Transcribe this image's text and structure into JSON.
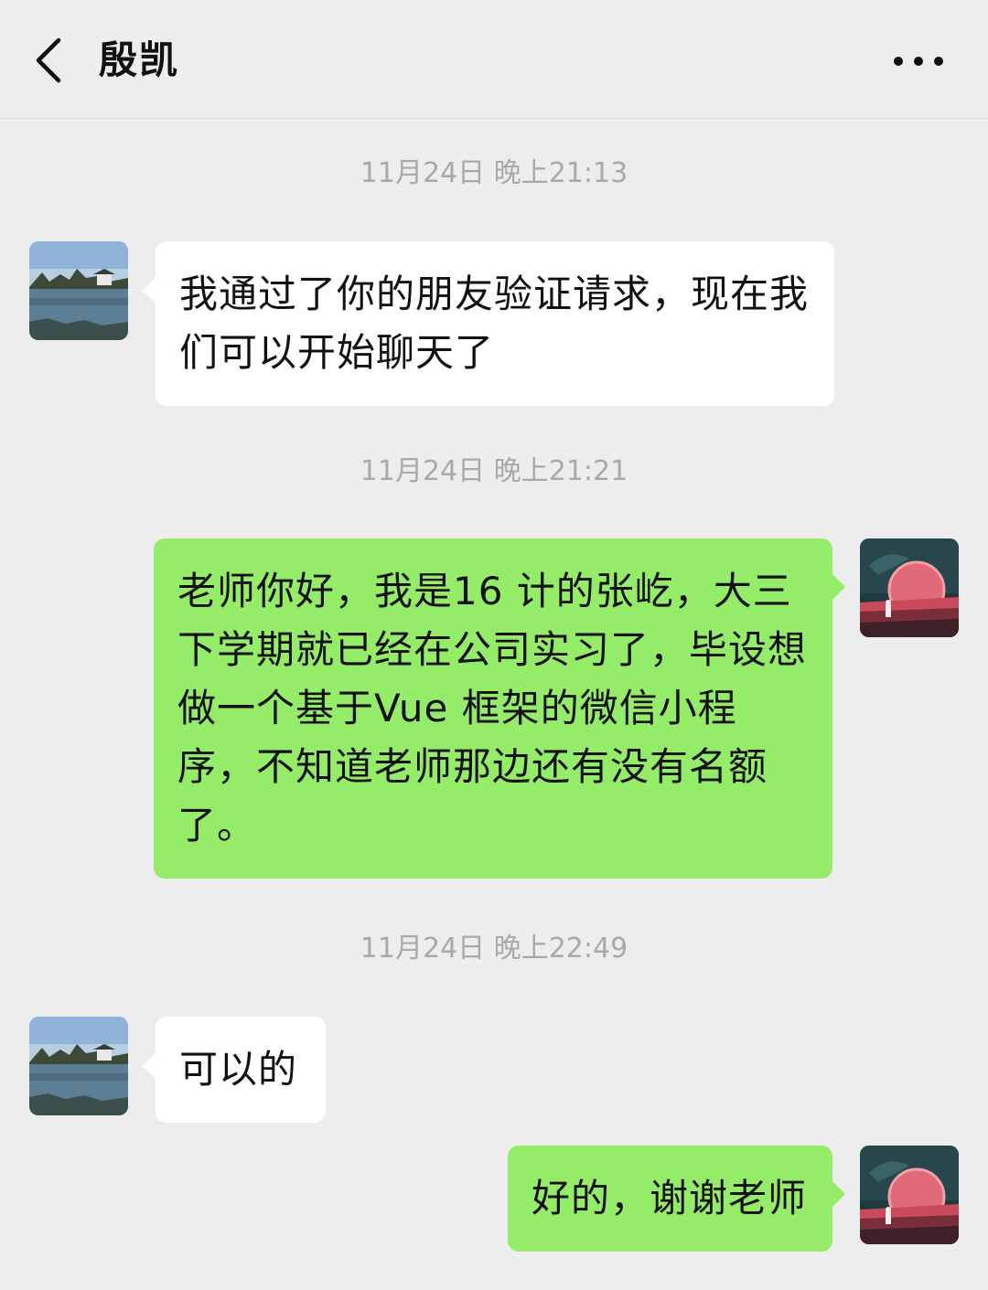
{
  "header": {
    "title": "殷凯",
    "back_icon": "chevron-left-icon",
    "more_icon": "more-dots-icon"
  },
  "messages": [
    {
      "type": "timestamp",
      "text": "11月24日 晚上21:13"
    },
    {
      "type": "incoming",
      "text": "我通过了你的朋友验证请求，现在我们可以开始聊天了"
    },
    {
      "type": "timestamp",
      "text": "11月24日 晚上21:21"
    },
    {
      "type": "outgoing",
      "text": "老师你好，我是16 计的张屹，大三下学期就已经在公司实习了，毕设想做一个基于Vue 框架的微信小程序，不知道老师那边还有没有名额了。"
    },
    {
      "type": "timestamp",
      "text": "11月24日 晚上22:49"
    },
    {
      "type": "incoming",
      "text": "可以的"
    },
    {
      "type": "outgoing",
      "text": "好的，谢谢老师"
    }
  ],
  "colors": {
    "background": "#ededed",
    "incoming_bubble": "#ffffff",
    "outgoing_bubble": "#95ec69",
    "timestamp": "#a9a9a9"
  }
}
